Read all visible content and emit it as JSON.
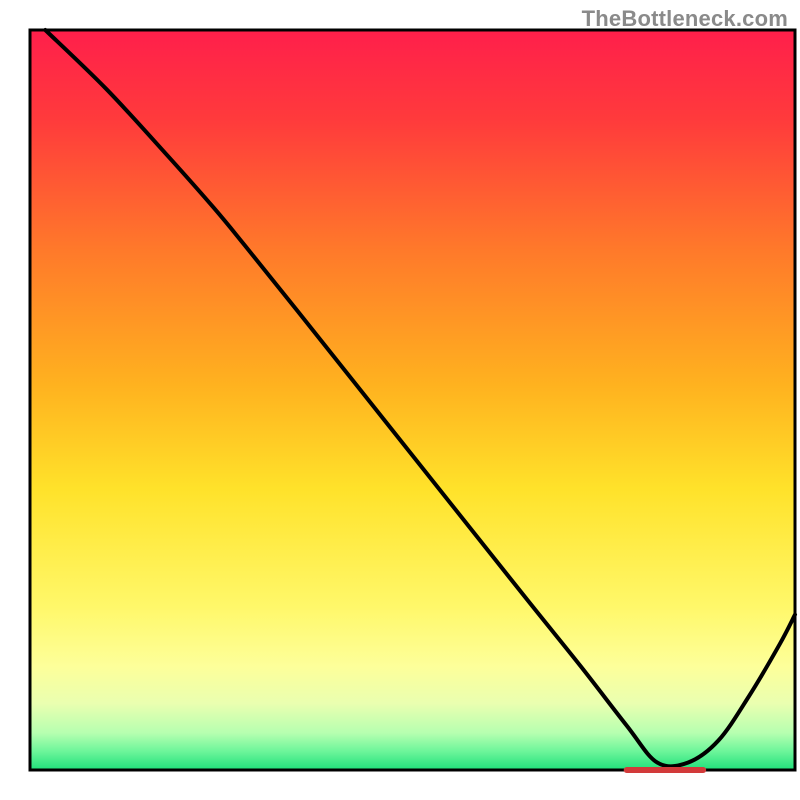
{
  "attribution": "TheBottleneck.com",
  "residual_label": "",
  "chart_data": {
    "type": "line",
    "title": "",
    "xlabel": "",
    "ylabel": "",
    "xlim": [
      0,
      100
    ],
    "ylim": [
      0,
      100
    ],
    "grid": false,
    "legend": false,
    "notes": "Rainbow vertical gradient background (red→yellow→green). Single black curve descending from top-left toward a minimum near x≈82 then rising. Short red tick segment along the x-axis near the curve minimum (x≈78–88).",
    "series": [
      {
        "name": "curve",
        "color": "#000000",
        "x": [
          2,
          10,
          18,
          24,
          28,
          35,
          45,
          55,
          65,
          72,
          78,
          82,
          86,
          90,
          94,
          98,
          100
        ],
        "y": [
          100,
          92,
          83,
          76,
          71,
          62,
          49,
          36,
          23,
          14,
          6,
          1,
          1,
          4,
          10,
          17,
          21
        ]
      }
    ],
    "residual_marker": {
      "x_start": 78,
      "x_end": 88,
      "y": 0,
      "color": "#d23a3a"
    },
    "gradient_stops": [
      {
        "offset": 0.0,
        "color": "#ff1f4b"
      },
      {
        "offset": 0.12,
        "color": "#ff3a3c"
      },
      {
        "offset": 0.3,
        "color": "#ff7a2a"
      },
      {
        "offset": 0.48,
        "color": "#ffb21f"
      },
      {
        "offset": 0.62,
        "color": "#ffe22a"
      },
      {
        "offset": 0.78,
        "color": "#fff86a"
      },
      {
        "offset": 0.86,
        "color": "#fdff9a"
      },
      {
        "offset": 0.91,
        "color": "#eaffb0"
      },
      {
        "offset": 0.95,
        "color": "#b6ffb0"
      },
      {
        "offset": 0.975,
        "color": "#6cf59a"
      },
      {
        "offset": 1.0,
        "color": "#1fe07a"
      }
    ]
  }
}
